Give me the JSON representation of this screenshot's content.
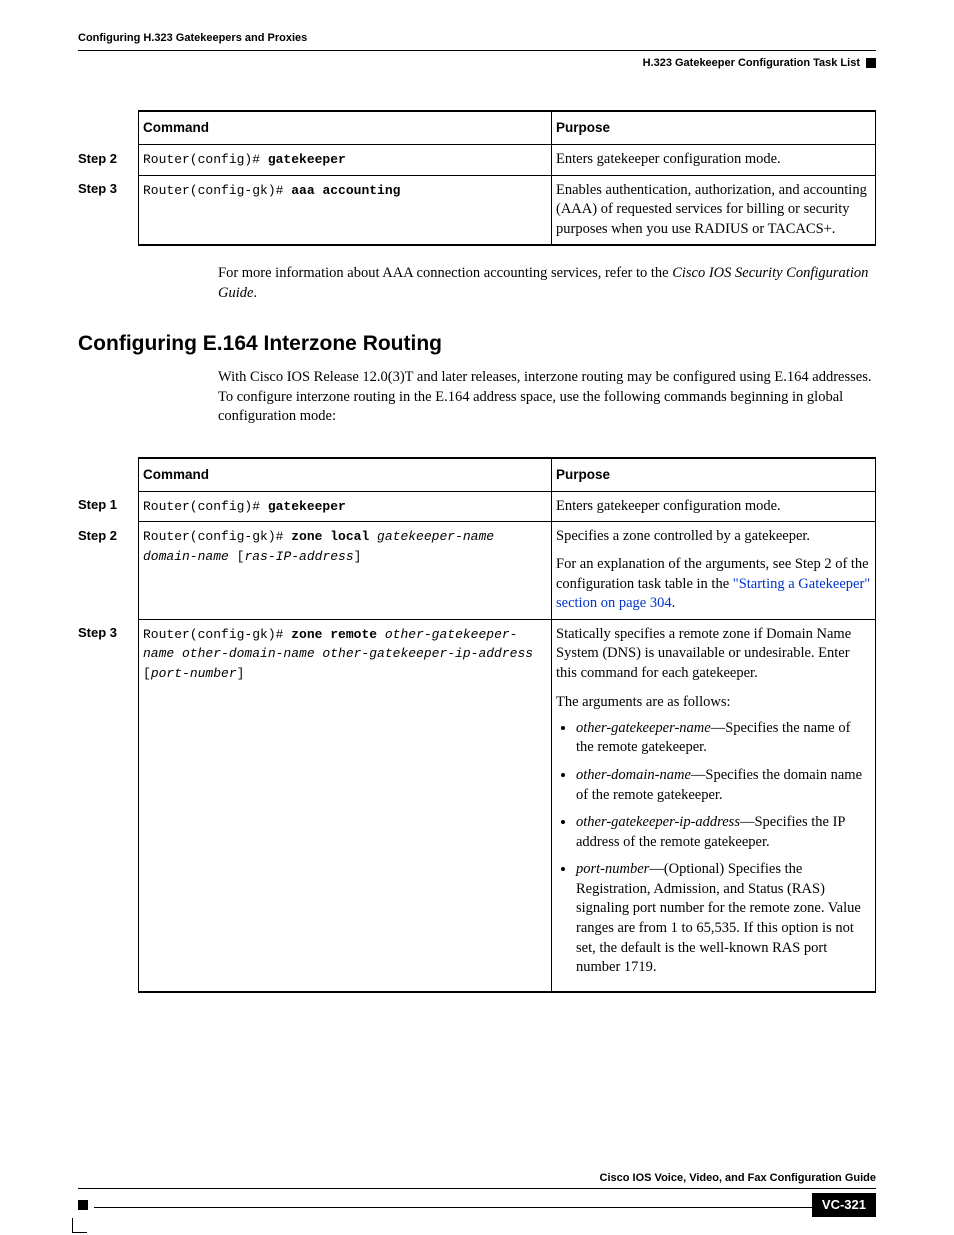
{
  "header": {
    "chapter_title": "Configuring H.323 Gatekeepers and Proxies",
    "section_title": "H.323 Gatekeeper Configuration Task List"
  },
  "table1": {
    "headers": {
      "command": "Command",
      "purpose": "Purpose"
    },
    "rows": [
      {
        "step": "Step 2",
        "cmd_prefix": "Router(config)# ",
        "cmd_bold": "gatekeeper",
        "purpose": "Enters gatekeeper configuration mode."
      },
      {
        "step": "Step 3",
        "cmd_prefix": "Router(config-gk)# ",
        "cmd_bold": "aaa accounting",
        "purpose": "Enables authentication, authorization, and accounting (AAA) of requested services for billing or security purposes when you use RADIUS or TACACS+."
      }
    ]
  },
  "para_after_table1_pre": "For more information about AAA connection accounting services, refer to the ",
  "para_after_table1_ital": "Cisco IOS Security Configuration Guide",
  "para_after_table1_post": ".",
  "section_heading": "Configuring E.164 Interzone Routing",
  "section_intro": "With Cisco IOS Release 12.0(3)T and later releases, interzone routing may be configured using E.164 addresses. To configure interzone routing in the E.164 address space, use the following commands beginning in global configuration mode:",
  "table2": {
    "headers": {
      "command": "Command",
      "purpose": "Purpose"
    },
    "row1": {
      "step": "Step 1",
      "cmd_prefix": "Router(config)# ",
      "cmd_bold": "gatekeeper",
      "purpose": "Enters gatekeeper configuration mode."
    },
    "row2": {
      "step": "Step 2",
      "cmd_prefix": "Router(config-gk)# ",
      "cmd_bold": "zone local",
      "cmd_ital1": " gatekeeper-name domain-name ",
      "cmd_plain": "[",
      "cmd_ital2": "ras-IP-address",
      "cmd_plain2": "]",
      "purpose_p1": "Specifies a zone controlled by a gatekeeper.",
      "purpose_p2_pre": "For an explanation of the arguments, see Step 2 of the configuration task table in the ",
      "purpose_p2_link": "\"Starting a Gatekeeper\" section on page 304",
      "purpose_p2_post": "."
    },
    "row3": {
      "step": "Step 3",
      "cmd_prefix": "Router(config-gk)# ",
      "cmd_bold": "zone remote",
      "cmd_ital1": " other-gatekeeper-name other-domain-name other-gatekeeper-ip-address ",
      "cmd_plain": "[",
      "cmd_ital2": "port-number",
      "cmd_plain2": "]",
      "purpose_p1": "Statically specifies a remote zone if Domain Name System (DNS) is unavailable or undesirable. Enter this command for each gatekeeper.",
      "purpose_p2": "The arguments are as follows:",
      "args": [
        {
          "term": "other-gatekeeper-name",
          "desc": "—Specifies the name of the remote gatekeeper."
        },
        {
          "term": "other-domain-name",
          "desc": "—Specifies the domain name of the remote gatekeeper."
        },
        {
          "term": "other-gatekeeper-ip-address",
          "desc": "—Specifies the IP address of the remote gatekeeper."
        },
        {
          "term": "port-number",
          "desc": "—(Optional) Specifies the Registration, Admission, and Status (RAS) signaling port number for the remote zone. Value ranges are from 1 to 65,535. If this option is not set, the default is the well-known RAS port number 1719."
        }
      ]
    }
  },
  "footer": {
    "doc_title": "Cisco IOS Voice, Video, and Fax Configuration Guide",
    "page_number": "VC-321"
  }
}
